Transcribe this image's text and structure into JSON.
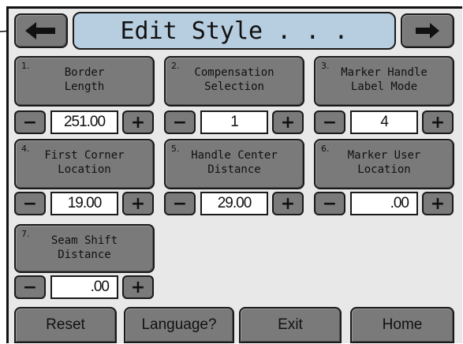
{
  "header": {
    "title": "Edit Style . . .",
    "back_icon": "arrow-left-icon",
    "forward_icon": "arrow-right-icon"
  },
  "params": [
    {
      "num": "1.",
      "line1": "Border",
      "line2": "Length",
      "value": "251.00",
      "minus": "−",
      "plus": "+"
    },
    {
      "num": "2.",
      "line1": "Compensation",
      "line2": "Selection",
      "value": "1",
      "minus": "−",
      "plus": "+"
    },
    {
      "num": "3.",
      "line1": "Marker Handle",
      "line2": "Label Mode",
      "value": "4",
      "minus": "−",
      "plus": "+"
    },
    {
      "num": "4.",
      "line1": "First Corner",
      "line2": "Location",
      "value": "19.00",
      "minus": "−",
      "plus": "+"
    },
    {
      "num": "5.",
      "line1": "Handle Center",
      "line2": "Distance",
      "value": "29.00",
      "minus": "−",
      "plus": "+"
    },
    {
      "num": "6.",
      "line1": "Marker User",
      "line2": "Location",
      "value": ".00",
      "minus": "−",
      "plus": "+"
    },
    {
      "num": "7.",
      "line1": "Seam Shift",
      "line2": "Distance",
      "value": ".00",
      "minus": "−",
      "plus": "+"
    }
  ],
  "footer": {
    "reset": "Reset",
    "language": "Language?",
    "exit": "Exit",
    "home": "Home"
  },
  "colors": {
    "panel": "#e8e8e8",
    "button": "#7a7a7a",
    "title_bar": "#b7cde0"
  }
}
